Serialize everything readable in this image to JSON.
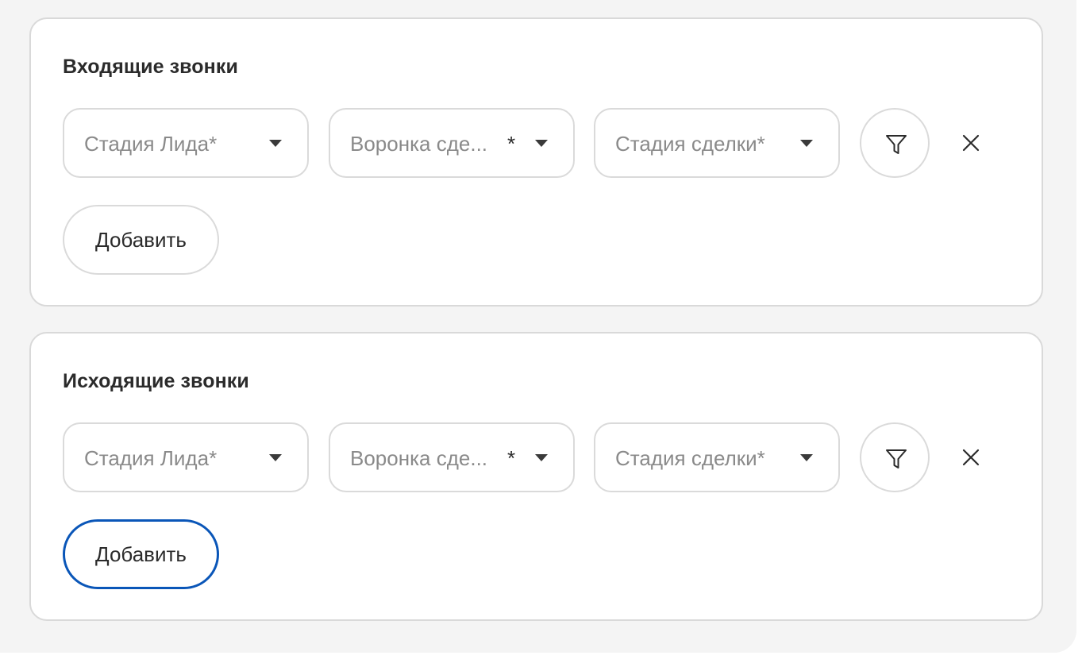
{
  "sections": [
    {
      "title": "Входящие звонки",
      "selects": [
        {
          "label": "Стадия Лида*"
        },
        {
          "label": "Воронка сде...",
          "required_mark": "*"
        },
        {
          "label": "Стадия сделки*"
        }
      ],
      "add_label": "Добавить"
    },
    {
      "title": "Исходящие звонки",
      "selects": [
        {
          "label": "Стадия Лида*"
        },
        {
          "label": "Воронка сде...",
          "required_mark": "*"
        },
        {
          "label": "Стадия сделки*"
        }
      ],
      "add_label": "Добавить"
    }
  ],
  "icons": {
    "caret": "chevron-down-icon",
    "filter": "filter-icon",
    "close": "close-icon"
  },
  "colors": {
    "page_bg": "#f4f4f4",
    "card_border": "#d9d9d9",
    "focus_ring": "#0a56b8",
    "placeholder": "#8a8a8a"
  }
}
